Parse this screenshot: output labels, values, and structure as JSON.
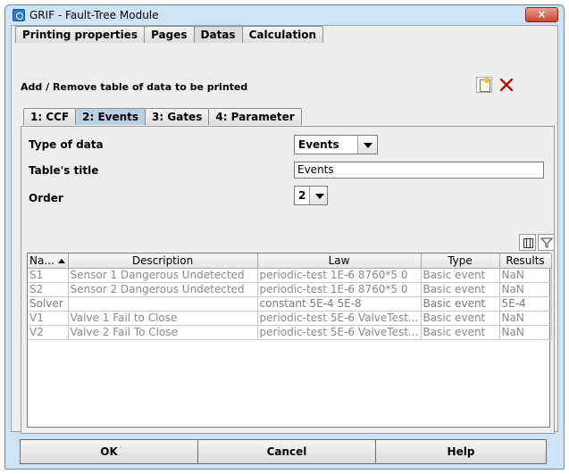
{
  "window": {
    "title": "GRIF - Fault-Tree Module",
    "close_glyph": "×"
  },
  "tabs": [
    "Printing properties",
    "Pages",
    "Datas",
    "Calculation"
  ],
  "active_tab": "Datas",
  "panel": {
    "heading": "Add / Remove table of data to be printed",
    "add_icon": "new-table-icon",
    "remove_icon": "delete-x-icon"
  },
  "inner_tabs": [
    "1: CCF",
    "2: Events",
    "3: Gates",
    "4: Parameter"
  ],
  "active_inner_tab": "2: Events",
  "form": {
    "type_label": "Type of data",
    "type_value": "Events",
    "title_label": "Table's title",
    "title_value": "Events",
    "order_label": "Order",
    "order_value": "2"
  },
  "table": {
    "columns": [
      "Na...",
      "Description",
      "Law",
      "Type",
      "Results"
    ],
    "rows": [
      [
        "S1",
        "Sensor 1 Dangerous Undetected",
        "periodic-test 1E-6 8760*5 0",
        "Basic event",
        "NaN"
      ],
      [
        "S2",
        "Sensor 2 Dangerous Undetected",
        "periodic-test 1E-6 8760*5 0",
        "Basic event",
        "NaN"
      ],
      [
        "Solver",
        "",
        "constant 5E-4 5E-8",
        "Basic event",
        "5E-4"
      ],
      [
        "V1",
        "Valve 1 Fail to Close",
        "periodic-test 5E-6 ValveTest...",
        "Basic event",
        "NaN"
      ],
      [
        "V2",
        "Valve 2 Fail To Close",
        "periodic-test 5E-6 ValveTest...",
        "Basic event",
        "NaN"
      ]
    ]
  },
  "buttons": {
    "ok": "OK",
    "cancel": "Cancel",
    "help": "Help"
  }
}
